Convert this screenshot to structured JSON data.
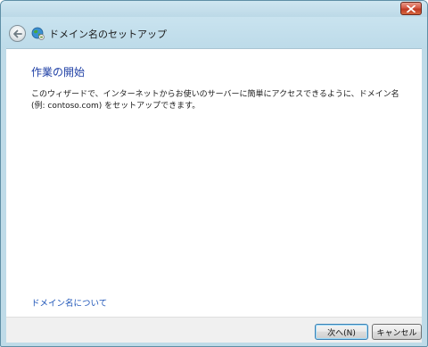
{
  "window": {
    "close_icon": "close-icon"
  },
  "header": {
    "title": "ドメイン名のセットアップ",
    "back_icon": "back-arrow-icon",
    "app_icon": "globe-network-icon"
  },
  "main": {
    "heading": "作業の開始",
    "description": "このウィザードで、インターネットからお使いのサーバーに簡単にアクセスできるように、ドメイン名 (例: contoso.com) をセットアップできます。",
    "help_link": "ドメイン名について"
  },
  "footer": {
    "next_label": "次へ(N)",
    "cancel_label": "キャンセル"
  },
  "colors": {
    "heading": "#1e3fa5",
    "link": "#1e55b8",
    "frame": "#bfdbe8"
  }
}
